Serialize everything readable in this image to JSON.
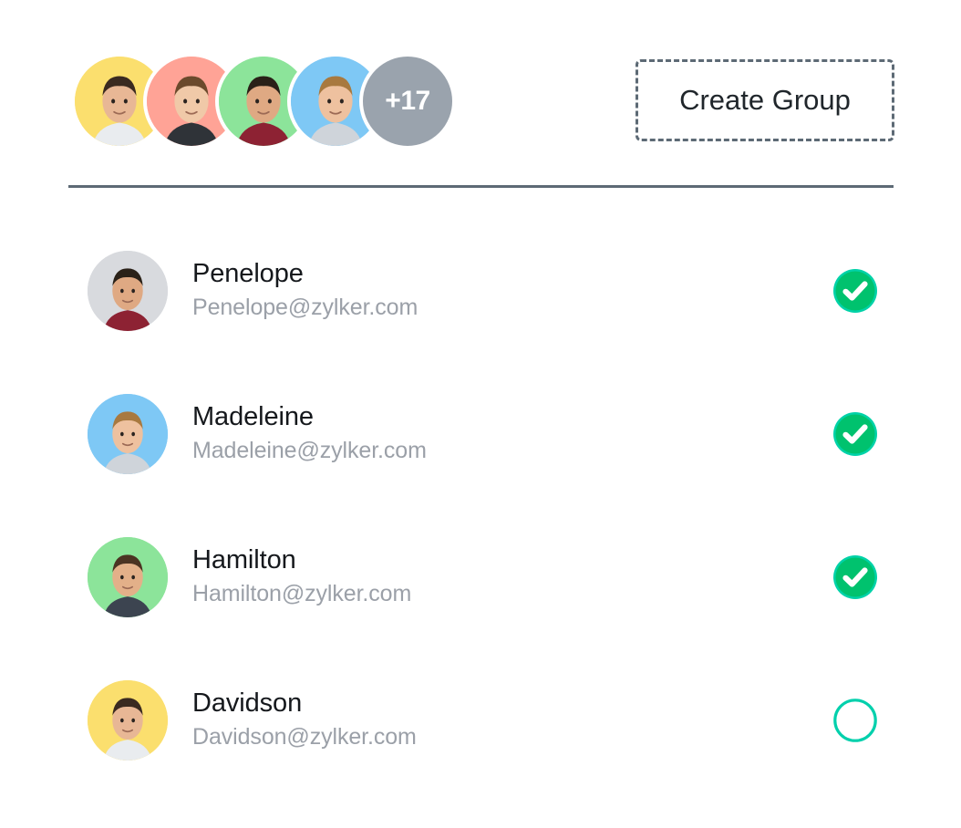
{
  "header": {
    "avatar_stack": {
      "name": "member-avatar-stack",
      "avatars": [
        {
          "id": "avatar-1",
          "bg": "#fbdf6e",
          "alt": "member-avatar-1"
        },
        {
          "id": "avatar-2",
          "bg": "#ffa396",
          "alt": "member-avatar-2"
        },
        {
          "id": "avatar-3",
          "bg": "#8ce49a",
          "alt": "member-avatar-3"
        },
        {
          "id": "avatar-4",
          "bg": "#7ec8f5",
          "alt": "member-avatar-4"
        }
      ],
      "overflow_label": "+17",
      "overflow_bg": "#9aa3ad",
      "overflow_text_color": "#ffffff"
    },
    "create_group_button": {
      "label": "Create Group",
      "border_color": "#5d6a75",
      "text_color": "#20262b",
      "style": "dashed"
    },
    "divider_color": "#5d6a75"
  },
  "colors": {
    "page_background": "#ffffff",
    "name_text": "#15181c",
    "email_text": "#9ba0a8",
    "checked_fill": "#00c26e",
    "checked_ring": "#00d2a8",
    "checkmark": "#ffffff",
    "unchecked_ring": "#00d0ac"
  },
  "contacts": [
    {
      "name": "Penelope",
      "email": "Penelope@zylker.com",
      "selected": true,
      "avatar_bg": "#d8dade",
      "avatar_name": "contact-avatar-penelope",
      "toggle_name": "select-toggle-penelope",
      "toggle_state": "checked"
    },
    {
      "name": "Madeleine",
      "email": "Madeleine@zylker.com",
      "selected": true,
      "avatar_bg": "#7ec8f5",
      "avatar_name": "contact-avatar-madeleine",
      "toggle_name": "select-toggle-madeleine",
      "toggle_state": "checked"
    },
    {
      "name": "Hamilton",
      "email": "Hamilton@zylker.com",
      "selected": true,
      "avatar_bg": "#8ce49a",
      "avatar_name": "contact-avatar-hamilton",
      "toggle_name": "select-toggle-hamilton",
      "toggle_state": "checked"
    },
    {
      "name": "Davidson",
      "email": "Davidson@zylker.com",
      "selected": false,
      "avatar_bg": "#fbdf6e",
      "avatar_name": "contact-avatar-davidson",
      "toggle_name": "select-toggle-davidson",
      "toggle_state": "unchecked"
    }
  ]
}
